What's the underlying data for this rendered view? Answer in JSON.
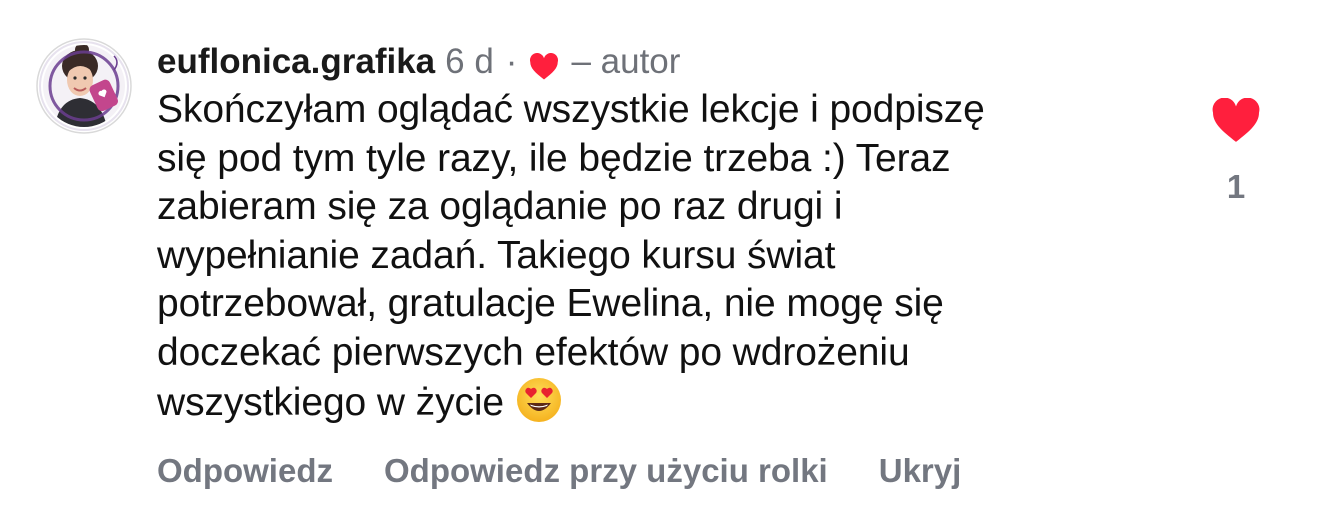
{
  "comment": {
    "username": "euflonica.grafika",
    "time_ago": "6 d",
    "separator": "·",
    "author_label": "– autor",
    "body_lines": [
      "Skończyłam oglądać wszystkie lekcje i podpiszę",
      "się pod tym tyle razy, ile będzie trzeba :) Teraz",
      "zabieram się za oglądanie po raz drugi i",
      "wypełnianie zadań. Takiego kursu świat",
      "potrzebował, gratulacje Ewelina, nie mogę się",
      "doczekać pierwszych efektów po wdrożeniu",
      "wszystkiego w życie"
    ],
    "trailing_emoji": "heart-eyes-emoji",
    "like_count": "1"
  },
  "actions": {
    "reply_label": "Odpowiedz",
    "reply_reel_label": "Odpowiedz przy użyciu rolki",
    "hide_label": "Ukryj"
  },
  "icons": {
    "avatar": "profile-avatar",
    "liked_by_author": "heart-icon",
    "like": "heart-icon"
  },
  "colors": {
    "like_red": "#ff1f3d",
    "muted_gray": "#737780",
    "text": "#111111"
  }
}
